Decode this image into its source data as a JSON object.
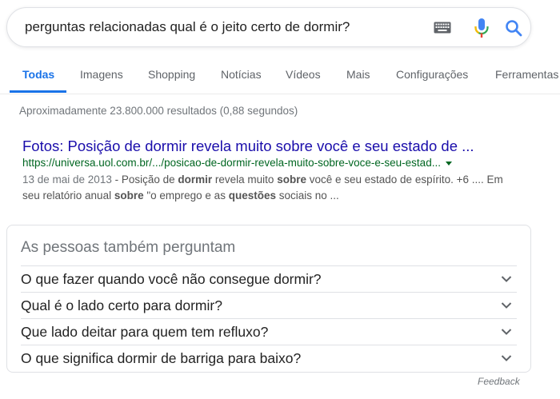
{
  "search": {
    "query": "perguntas relacionadas qual é o jeito certo de dormir?"
  },
  "icons": {
    "keyboard": "keyboard-icon",
    "mic": "mic-icon",
    "search": "search-icon",
    "chevron": "chevron-down-icon"
  },
  "colors": {
    "accent": "#1a73e8",
    "link": "#1a0dab",
    "url": "#006621",
    "mic_blue": "#4285f4",
    "mic_red": "#ea4335",
    "mic_yellow": "#fbbc05",
    "mic_green": "#34a853"
  },
  "tabs": [
    {
      "label": "Todas",
      "active": true
    },
    {
      "label": "Imagens"
    },
    {
      "label": "Shopping"
    },
    {
      "label": "Notícias"
    },
    {
      "label": "Vídeos"
    },
    {
      "label": "Mais"
    },
    {
      "label": "Configurações"
    },
    {
      "label": "Ferramentas"
    }
  ],
  "stats": "Aproximadamente 23.800.000 resultados (0,88 segundos)",
  "result": {
    "title": "Fotos: Posição de dormir revela muito sobre você e seu estado de ...",
    "url": "https://universa.uol.com.br/.../posicao-de-dormir-revela-muito-sobre-voce-e-seu-estad...",
    "date": "13 de mai de 2013",
    "snippet": {
      "s1": " - Posição de ",
      "b1": "dormir",
      "s2": " revela muito ",
      "b2": "sobre",
      "s3": " você e seu estado de espírito. +6 .... Em seu relatório anual ",
      "b3": "sobre",
      "s4": " \"o emprego e as ",
      "b4": "questões",
      "s5": " sociais no ..."
    }
  },
  "paa": {
    "heading": "As pessoas também perguntam",
    "questions": [
      "O que fazer quando você não consegue dormir?",
      "Qual é o lado certo para dormir?",
      "Que lado deitar para quem tem refluxo?",
      "O que significa dormir de barriga para baixo?"
    ]
  },
  "feedback": "Feedback"
}
